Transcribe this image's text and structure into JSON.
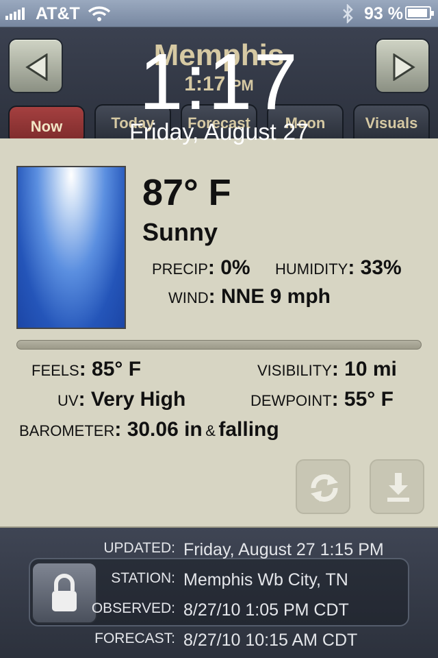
{
  "status_bar": {
    "carrier": "AT&T",
    "battery": "93 %"
  },
  "lock_screen": {
    "time": "1:17",
    "date": "Friday, August 27"
  },
  "header": {
    "city": "Memphis",
    "time": "1:17",
    "ampm": "PM",
    "tabs": [
      "Now",
      "Today",
      "Forecast",
      "Moon",
      "Visuals"
    ],
    "active_tab": "Now"
  },
  "current": {
    "temp": "87° F",
    "condition": "Sunny",
    "precip_label": "PRECIP",
    "precip": "0%",
    "humidity_label": "HUMIDITY",
    "humidity": "33%",
    "wind_label": "WIND",
    "wind": "NNE 9 mph",
    "feels_label": "FEELS",
    "feels": "85° F",
    "visibility_label": "VISIBILITY",
    "visibility": "10 mi",
    "uv_label": "UV",
    "uv": "Very High",
    "dewpoint_label": "DEWPOINT",
    "dewpoint": "55° F",
    "barometer_label": "BAROMETER",
    "barometer": "30.06 in",
    "barometer_amp": "&",
    "barometer_trend": "falling"
  },
  "footer": {
    "updated_label": "UPDATED",
    "updated": "Friday, August 27 1:15 PM",
    "station_label": "STATION",
    "station": "Memphis Wb City, TN",
    "observed_label": "OBSERVED",
    "observed": "8/27/10 1:05 PM CDT",
    "forecast_label": "FORECAST",
    "forecast": "8/27/10 10:15 AM CDT"
  },
  "icons": {
    "prev": "left-arrow-icon",
    "next": "right-arrow-icon",
    "refresh": "refresh-icon",
    "download": "download-icon",
    "lock": "padlock-icon"
  },
  "colors": {
    "active_tab": "#8e3434",
    "panel": "#d7d5c3",
    "header_text": "#d6c9a3"
  }
}
